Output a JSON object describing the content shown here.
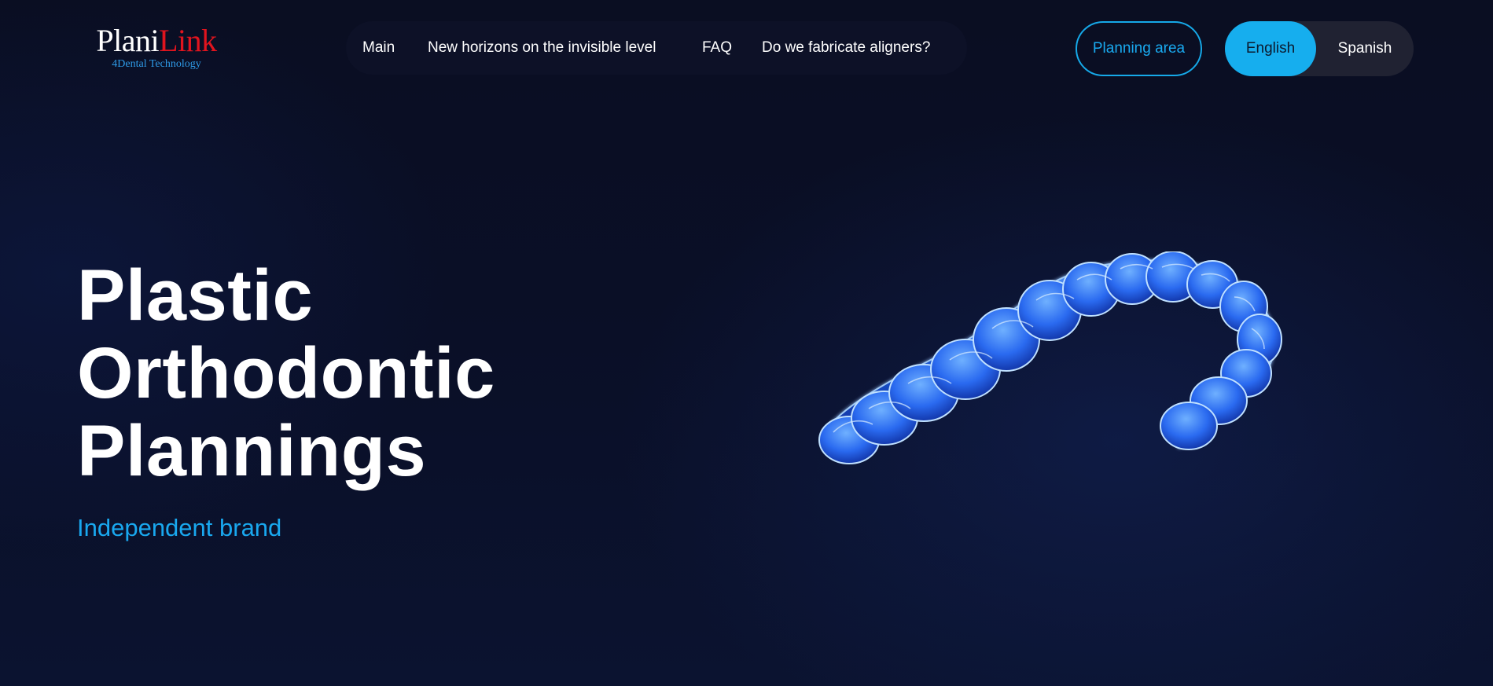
{
  "header": {
    "logo": {
      "part1": "Plani",
      "part2": "Link",
      "tagline": "4Dental Technology",
      "colors": {
        "part1": "#ffffff",
        "part2": "#e0141e",
        "tagline": "#2e9be8"
      }
    },
    "nav": {
      "items": [
        {
          "label": "Main"
        },
        {
          "label": "New horizons on the invisible level"
        },
        {
          "label": "FAQ"
        },
        {
          "label": "Do we fabricate aligners?"
        }
      ]
    },
    "planning_button": {
      "label": "Planning area"
    },
    "language_switch": {
      "options": [
        {
          "label": "English",
          "selected": true
        },
        {
          "label": "Spanish",
          "selected": false
        }
      ]
    }
  },
  "hero": {
    "title_lines": [
      "Plastic",
      "Orthodontic",
      "Plannings"
    ],
    "subtitle": "Independent brand",
    "image": {
      "icon": "clear-aligner-illustration"
    }
  },
  "colors": {
    "background": "#0a0f27",
    "accent": "#16aeee",
    "text": "#ffffff"
  }
}
